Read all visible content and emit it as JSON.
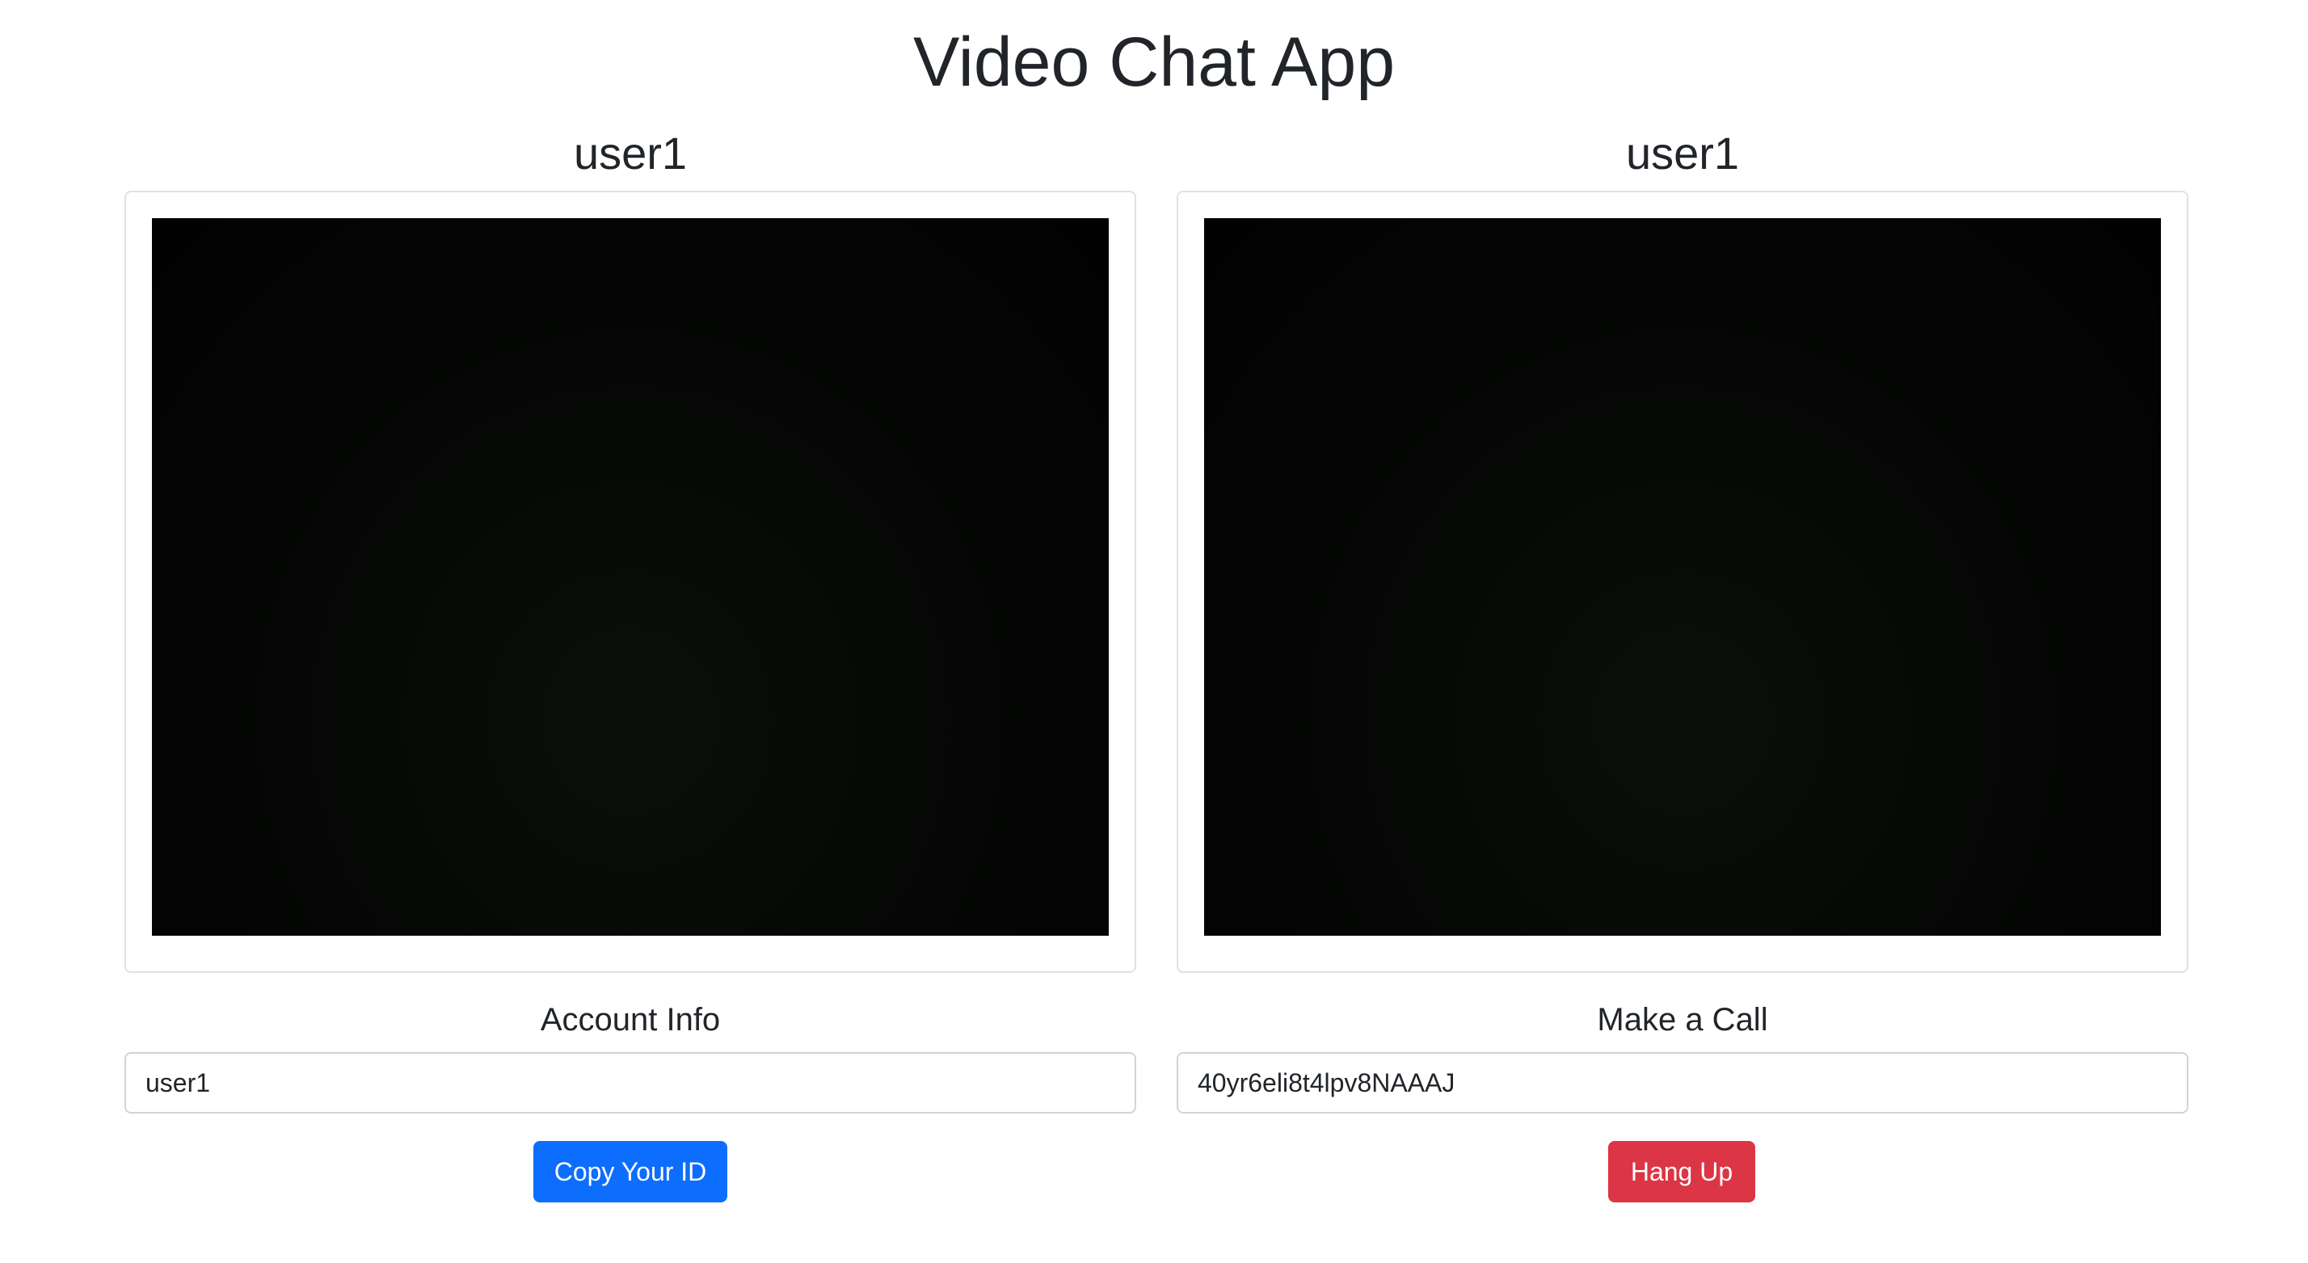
{
  "app": {
    "title": "Video Chat App"
  },
  "local_panel": {
    "user_name": "user1",
    "section_label": "Account Info",
    "input_value": "user1",
    "button_label": "Copy Your ID",
    "button_color": "#0d6efd"
  },
  "remote_panel": {
    "user_name": "user1",
    "section_label": "Make a Call",
    "input_value": "40yr6eli8t4lpv8NAAAJ",
    "button_label": "Hang Up",
    "button_color": "#dc3545"
  }
}
